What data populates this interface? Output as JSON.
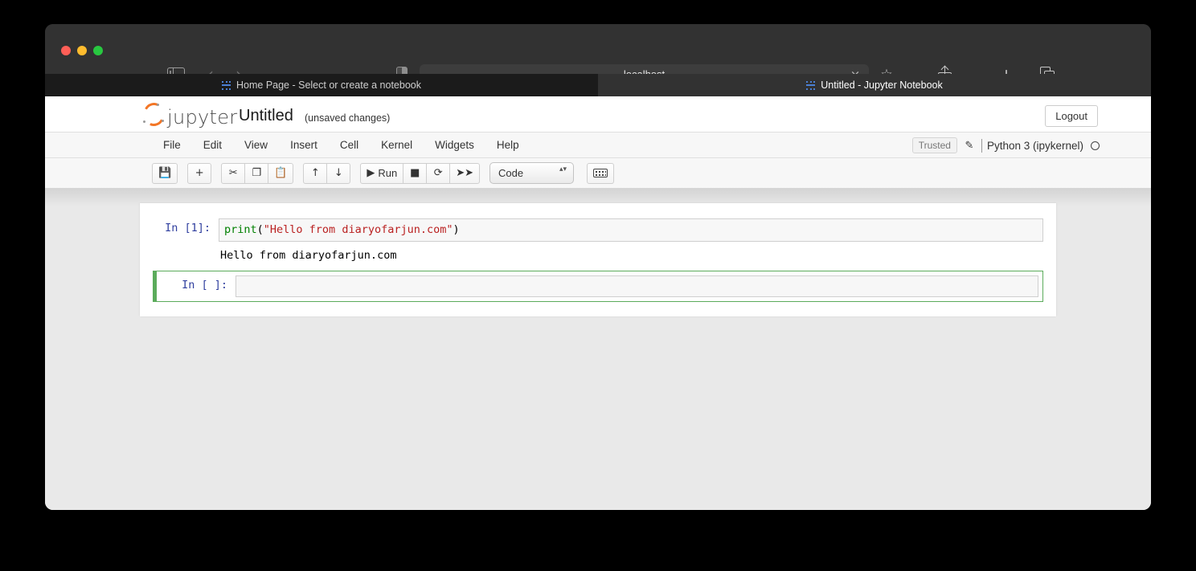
{
  "browser": {
    "traffic_lights": [
      "close",
      "minimize",
      "zoom"
    ],
    "sidebar_toggle_icon": "sidebar-icon",
    "back_icon": "‹",
    "forward_icon": "›",
    "shield_icon": "privacy-shield-icon",
    "url": "localhost",
    "url_clear_icon": "×",
    "bookmark_icon": "☆",
    "share_icon": "share-icon",
    "new_tab_icon": "+",
    "tab_overview_icon": "tabs-icon",
    "tabs": [
      {
        "title": "Home Page - Select or create a notebook",
        "active": false
      },
      {
        "title": "Untitled - Jupyter Notebook",
        "active": true
      }
    ]
  },
  "jupyter": {
    "brand": "jupyter",
    "notebook_title": "Untitled",
    "save_status": "(unsaved changes)",
    "logout_label": "Logout",
    "menus": [
      "File",
      "Edit",
      "View",
      "Insert",
      "Cell",
      "Kernel",
      "Widgets",
      "Help"
    ],
    "trusted_label": "Trusted",
    "edit_icon": "✎",
    "kernel_name": "Python 3 (ipykernel)",
    "kernel_status": "idle",
    "toolbar": {
      "save_icon": "💾",
      "save_name": "save-and-checkpoint",
      "insert_icon": "+",
      "insert_name": "insert-cell-below",
      "cut_icon": "✂",
      "copy_icon": "❐",
      "paste_icon": "📋",
      "move_up_icon": "↑",
      "move_down_icon": "↓",
      "run_icon": "▶",
      "run_label": "Run",
      "stop_icon": "■",
      "restart_icon": "⟳",
      "restart_run_all_icon": "➤➤",
      "cell_type": "Code",
      "cell_type_arrows": "▴▾",
      "keyboard_icon": "keyboard-icon"
    },
    "cells": [
      {
        "prompt": "In [1]:",
        "selected": false,
        "source_tokens": [
          {
            "text": "print",
            "type": "fn"
          },
          {
            "text": "(",
            "type": "pn"
          },
          {
            "text": "\"Hello from diaryofarjun.com\"",
            "type": "str"
          },
          {
            "text": ")",
            "type": "pn"
          }
        ],
        "output": "Hello from diaryofarjun.com"
      },
      {
        "prompt": "In [ ]:",
        "selected": true,
        "source_tokens": [],
        "output": null
      }
    ]
  },
  "colors": {
    "jupyter_orange": "#f37626",
    "selected_cell_green": "#5bab5b",
    "prompt_blue": "#303f9f",
    "string_red": "#ba2121",
    "function_green": "#008000",
    "chrome_dark": "#323232",
    "page_gray": "#e9e9e9"
  }
}
